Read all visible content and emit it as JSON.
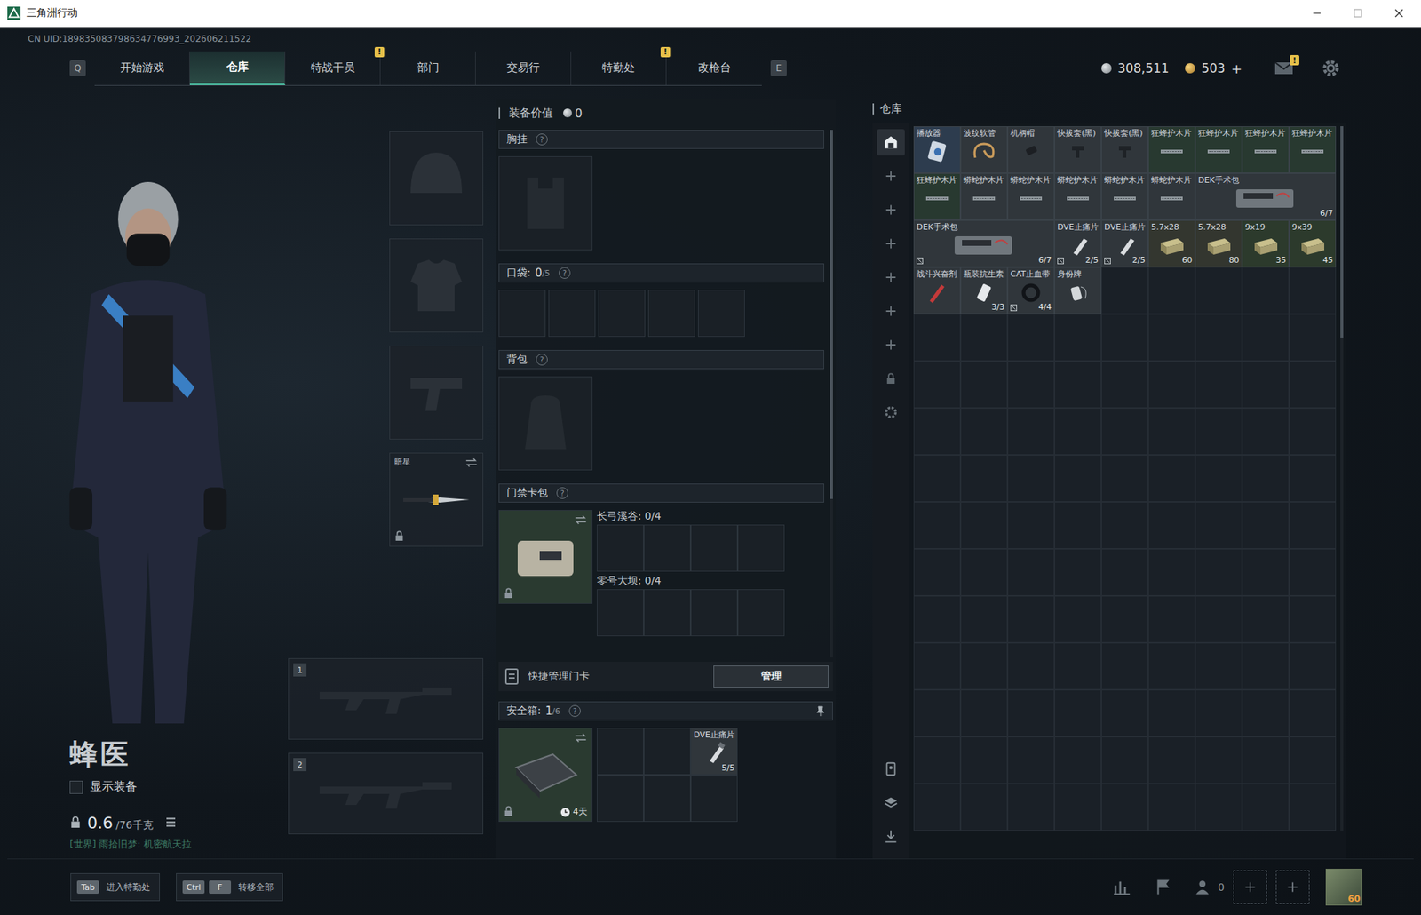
{
  "window": {
    "title": "三角洲行动"
  },
  "uid": "CN UID:189835083798634776993_202606211522",
  "nav": {
    "left_key": "Q",
    "right_key": "E",
    "alert_glyph": "!",
    "tabs": [
      {
        "label": "开始游戏",
        "selected": false,
        "alert": false
      },
      {
        "label": "仓库",
        "selected": true,
        "alert": false
      },
      {
        "label": "特战干员",
        "selected": false,
        "alert": true
      },
      {
        "label": "部门",
        "selected": false,
        "alert": false
      },
      {
        "label": "交易行",
        "selected": false,
        "alert": false
      },
      {
        "label": "特勤处",
        "selected": false,
        "alert": true
      },
      {
        "label": "改枪台",
        "selected": false,
        "alert": false
      }
    ]
  },
  "wallet": {
    "coins": "308,511",
    "tickets": "503",
    "add": "+"
  },
  "mail": {
    "unread": true,
    "badge": "!"
  },
  "operator": {
    "name": "蜂医",
    "show_gear": {
      "label": "显示装备",
      "checked": false
    },
    "weight": "0.6",
    "weight_max": "/76千克",
    "chat": "[世界] 雨拾旧梦: 机密航天拉"
  },
  "equipment": [
    {
      "slot": "helmet",
      "label": "",
      "locked": false
    },
    {
      "slot": "armor",
      "label": "",
      "locked": false
    },
    {
      "slot": "pistol",
      "label": "",
      "locked": false
    },
    {
      "slot": "melee",
      "label": "暗星",
      "locked": true
    }
  ],
  "weapon_slots": [
    {
      "number": "1"
    },
    {
      "number": "2"
    }
  ],
  "loadout": {
    "value_label": "装备价值",
    "value": "0",
    "help": "?",
    "chest": {
      "label": "胸挂"
    },
    "pockets": {
      "label": "口袋:",
      "count": "0",
      "capacity": "/5",
      "slots": 5
    },
    "backpack": {
      "label": "背包"
    },
    "keycard": {
      "label": "门禁卡包",
      "locked": true,
      "maps": [
        {
          "name": "长弓溪谷:",
          "count": "0/4",
          "slots": 4
        },
        {
          "name": "零号大坝:",
          "count": "0/4",
          "slots": 4
        }
      ],
      "quick_label": "快捷管理门卡",
      "button": "管理"
    },
    "safebox": {
      "label": "安全箱:",
      "count": "1",
      "capacity": "/6",
      "timer": "4天",
      "locked": true,
      "cells": [
        {
          "empty": true,
          "name": "",
          "count": ""
        },
        {
          "empty": true,
          "name": "",
          "count": ""
        },
        {
          "empty": false,
          "name": "DVE止痛片",
          "count": "5/5"
        },
        {
          "empty": true,
          "name": "",
          "count": ""
        },
        {
          "empty": true,
          "name": "",
          "count": ""
        },
        {
          "empty": true,
          "name": "",
          "count": ""
        }
      ]
    }
  },
  "warehouse": {
    "title": "仓库",
    "sidebar_top": [
      {
        "kind": "home",
        "selected": true
      },
      {
        "kind": "add",
        "selected": false
      },
      {
        "kind": "add",
        "selected": false
      },
      {
        "kind": "add",
        "selected": false
      },
      {
        "kind": "add",
        "selected": false
      },
      {
        "kind": "add",
        "selected": false
      },
      {
        "kind": "add",
        "selected": false
      },
      {
        "kind": "lock",
        "selected": false
      },
      {
        "kind": "settings",
        "selected": false
      }
    ],
    "sidebar_bottom": [
      {
        "kind": "card",
        "selected": false
      },
      {
        "kind": "layers",
        "selected": false
      },
      {
        "kind": "transfer",
        "selected": false
      }
    ],
    "items": [
      {
        "name": "播放器",
        "kind": "device",
        "count": "",
        "cells": 1,
        "marked": false,
        "color": "#2d3c4e"
      },
      {
        "name": "波纹软管",
        "kind": "hose",
        "count": "",
        "cells": 1,
        "marked": false,
        "color": "#30363b"
      },
      {
        "name": "机柄帽",
        "kind": "part",
        "count": "",
        "cells": 1,
        "marked": false,
        "color": "#30363b"
      },
      {
        "name": "快拔套(黑)",
        "kind": "holster",
        "count": "",
        "cells": 1,
        "marked": false,
        "color": "#30363b"
      },
      {
        "name": "快拔套(黑)",
        "kind": "holster",
        "count": "",
        "cells": 1,
        "marked": false,
        "color": "#30363b"
      },
      {
        "name": "狂蜂护木片",
        "kind": "handguard",
        "count": "",
        "cells": 1,
        "marked": false,
        "color": "#283930"
      },
      {
        "name": "狂蜂护木片",
        "kind": "handguard",
        "count": "",
        "cells": 1,
        "marked": false,
        "color": "#283930"
      },
      {
        "name": "狂蜂护木片",
        "kind": "handguard",
        "count": "",
        "cells": 1,
        "marked": false,
        "color": "#283930"
      },
      {
        "name": "狂蜂护木片",
        "kind": "handguard",
        "count": "",
        "cells": 1,
        "marked": false,
        "color": "#283930"
      },
      {
        "name": "狂蜂护木片",
        "kind": "handguard",
        "count": "",
        "cells": 1,
        "marked": false,
        "color": "#283930"
      },
      {
        "name": "蟒蛇护木片",
        "kind": "handguard",
        "count": "",
        "cells": 1,
        "marked": false,
        "color": "#30363b"
      },
      {
        "name": "蟒蛇护木片",
        "kind": "handguard",
        "count": "",
        "cells": 1,
        "marked": false,
        "color": "#30363b"
      },
      {
        "name": "蟒蛇护木片",
        "kind": "handguard",
        "count": "",
        "cells": 1,
        "marked": false,
        "color": "#30363b"
      },
      {
        "name": "蟒蛇护木片",
        "kind": "handguard",
        "count": "",
        "cells": 1,
        "marked": false,
        "color": "#30363b"
      },
      {
        "name": "蟒蛇护木片",
        "kind": "handguard",
        "count": "",
        "cells": 1,
        "marked": false,
        "color": "#30363b"
      },
      {
        "name": "DEK手术包",
        "kind": "medkit",
        "count": "6/7",
        "cells": 3,
        "marked": false,
        "color": "#30363b"
      },
      {
        "name": "DEK手术包",
        "kind": "medkit",
        "count": "6/7",
        "cells": 3,
        "marked": true,
        "color": "#30363b"
      },
      {
        "name": "DVE止痛片",
        "kind": "injector",
        "count": "2/5",
        "cells": 1,
        "marked": true,
        "color": "#30363b"
      },
      {
        "name": "DVE止痛片",
        "kind": "injector",
        "count": "2/5",
        "cells": 1,
        "marked": true,
        "color": "#30363b"
      },
      {
        "name": "5.7x28",
        "kind": "ammo",
        "count": "60",
        "cells": 1,
        "marked": false,
        "color": "#33362f"
      },
      {
        "name": "5.7x28",
        "kind": "ammo",
        "count": "80",
        "cells": 1,
        "marked": false,
        "color": "#33362f"
      },
      {
        "name": "9x19",
        "kind": "ammo",
        "count": "35",
        "cells": 1,
        "marked": false,
        "color": "#2c3a2c"
      },
      {
        "name": "9x39",
        "kind": "ammo",
        "count": "45",
        "cells": 1,
        "marked": false,
        "color": "#2c3a2c"
      },
      {
        "name": "战斗兴奋剂",
        "kind": "stim",
        "count": "",
        "cells": 1,
        "marked": false,
        "color": "#30363b"
      },
      {
        "name": "瓶装抗生素",
        "kind": "bottle",
        "count": "3/3",
        "cells": 1,
        "marked": false,
        "color": "#30363b"
      },
      {
        "name": "CAT止血带",
        "kind": "tourniquet",
        "count": "4/4",
        "cells": 1,
        "marked": true,
        "color": "#30363b"
      },
      {
        "name": "身份牌",
        "kind": "tag",
        "count": "",
        "cells": 1,
        "marked": false,
        "color": "#30363b"
      }
    ]
  },
  "bottom_bar": {
    "hints": [
      {
        "keys": [
          "Tab"
        ],
        "label": "进入特勤处"
      },
      {
        "keys": [
          "Ctrl",
          "F"
        ],
        "label": "转移全部"
      }
    ],
    "squad_count": "0",
    "level": "60"
  }
}
